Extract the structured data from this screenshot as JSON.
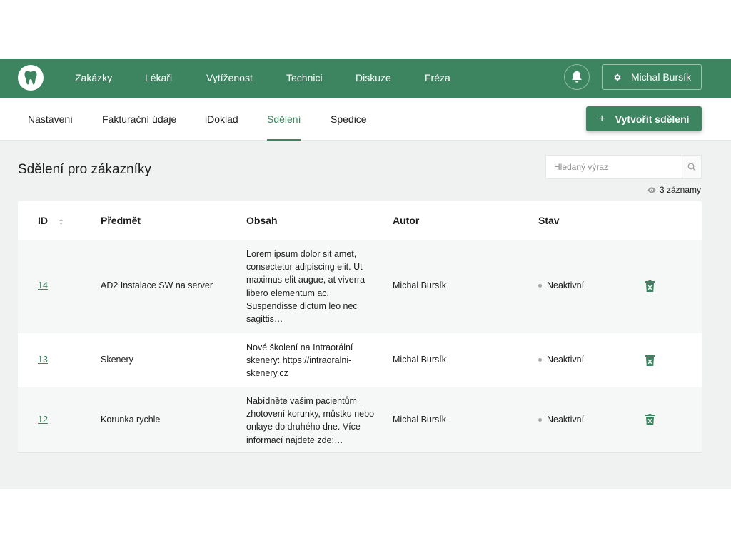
{
  "header": {
    "nav": [
      "Zakázky",
      "Lékaři",
      "Vytíženost",
      "Technici",
      "Diskuze",
      "Fréza"
    ],
    "user_name": "Michal Bursík"
  },
  "subnav": {
    "tabs": [
      "Nastavení",
      "Fakturační údaje",
      "iDoklad",
      "Sdělení",
      "Spedice"
    ],
    "active_tab": "Sdělení",
    "create_button": "Vytvořit sdělení"
  },
  "page": {
    "title": "Sdělení pro zákazníky",
    "search_placeholder": "Hledaný výraz",
    "record_count": "3 záznamy"
  },
  "table": {
    "columns": [
      "ID",
      "Předmět",
      "Obsah",
      "Autor",
      "Stav"
    ],
    "rows": [
      {
        "id": "14",
        "subject": "AD2 Instalace SW na server",
        "content_lines": [
          "Lorem ipsum dolor sit amet,",
          "consectetur adipiscing elit. Ut",
          "maximus elit augue, at viverra",
          "libero elementum ac.",
          "Suspendisse dictum leo nec",
          "sagittis…"
        ],
        "author": "Michal Bursík",
        "status": "Neaktivní"
      },
      {
        "id": "13",
        "subject": "Skenery",
        "content_lines": [
          "Nové školení na Intraorální",
          "skenery:  https://intraoralni-",
          "skenery.cz"
        ],
        "author": "Michal Bursík",
        "status": "Neaktivní"
      },
      {
        "id": "12",
        "subject": "Korunka rychle",
        "content_lines": [
          "Nabídněte vašim pacientům",
          "zhotovení korunky, můstku nebo",
          "onlaye do druhého dne. Více",
          "informací najdete zde:…"
        ],
        "author": "Michal Bursík",
        "status": "Neaktivní"
      }
    ]
  },
  "colors": {
    "brand_green": "#3d8560",
    "page_background": "#f0f1f1",
    "status_dot": "#a6a6a6"
  },
  "icons": [
    "tooth-logo-icon",
    "bell-icon",
    "gear-icon",
    "plus-icon",
    "search-icon",
    "eye-icon",
    "sort-icon",
    "trash-icon"
  ]
}
